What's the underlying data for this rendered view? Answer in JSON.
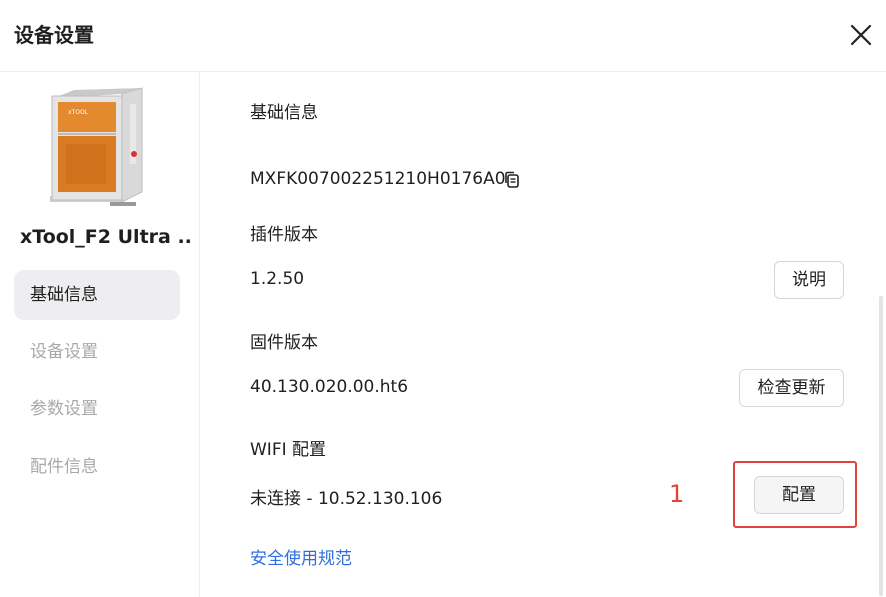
{
  "dialog": {
    "title": "设备设置",
    "close_icon": "close-icon"
  },
  "sidebar": {
    "device_name": "xTool_F2 Ultra ...",
    "device_image_label": "xTOOL",
    "items": [
      {
        "label": "基础信息",
        "active": true
      },
      {
        "label": "设备设置",
        "active": false
      },
      {
        "label": "参数设置",
        "active": false
      },
      {
        "label": "配件信息",
        "active": false
      }
    ]
  },
  "main": {
    "section_title": "基础信息",
    "serial_number": "MXFK007002251210H0176A0",
    "plugin_version": {
      "label": "插件版本",
      "value": "1.2.50",
      "button": "说明"
    },
    "firmware_version": {
      "label": "固件版本",
      "value": "40.130.020.00.ht6",
      "button": "检查更新"
    },
    "wifi": {
      "label": "WIFI 配置",
      "value": "未连接 - 10.52.130.106",
      "button": "配置"
    },
    "safety_link": "安全使用规范"
  },
  "annotation": {
    "number": "1",
    "color": "#e0453a"
  },
  "colors": {
    "accent_link": "#2f6ee0",
    "active_nav_bg": "#eeeef0",
    "inactive_nav_text": "#a8a8a8"
  }
}
